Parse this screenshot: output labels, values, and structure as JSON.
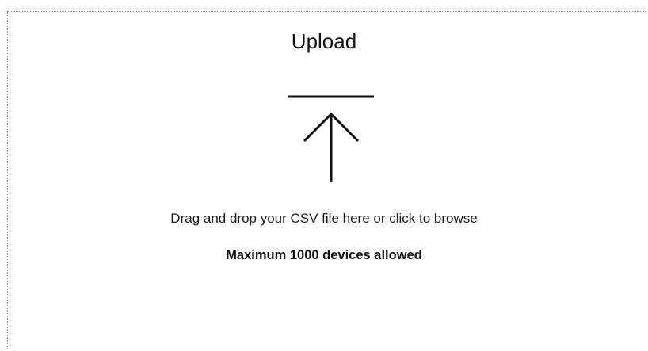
{
  "upload": {
    "title": "Upload",
    "icon": "upload-arrow-icon",
    "hint": "Drag and drop your CSV file here or click to browse",
    "limit": "Maximum 1000 devices allowed"
  }
}
